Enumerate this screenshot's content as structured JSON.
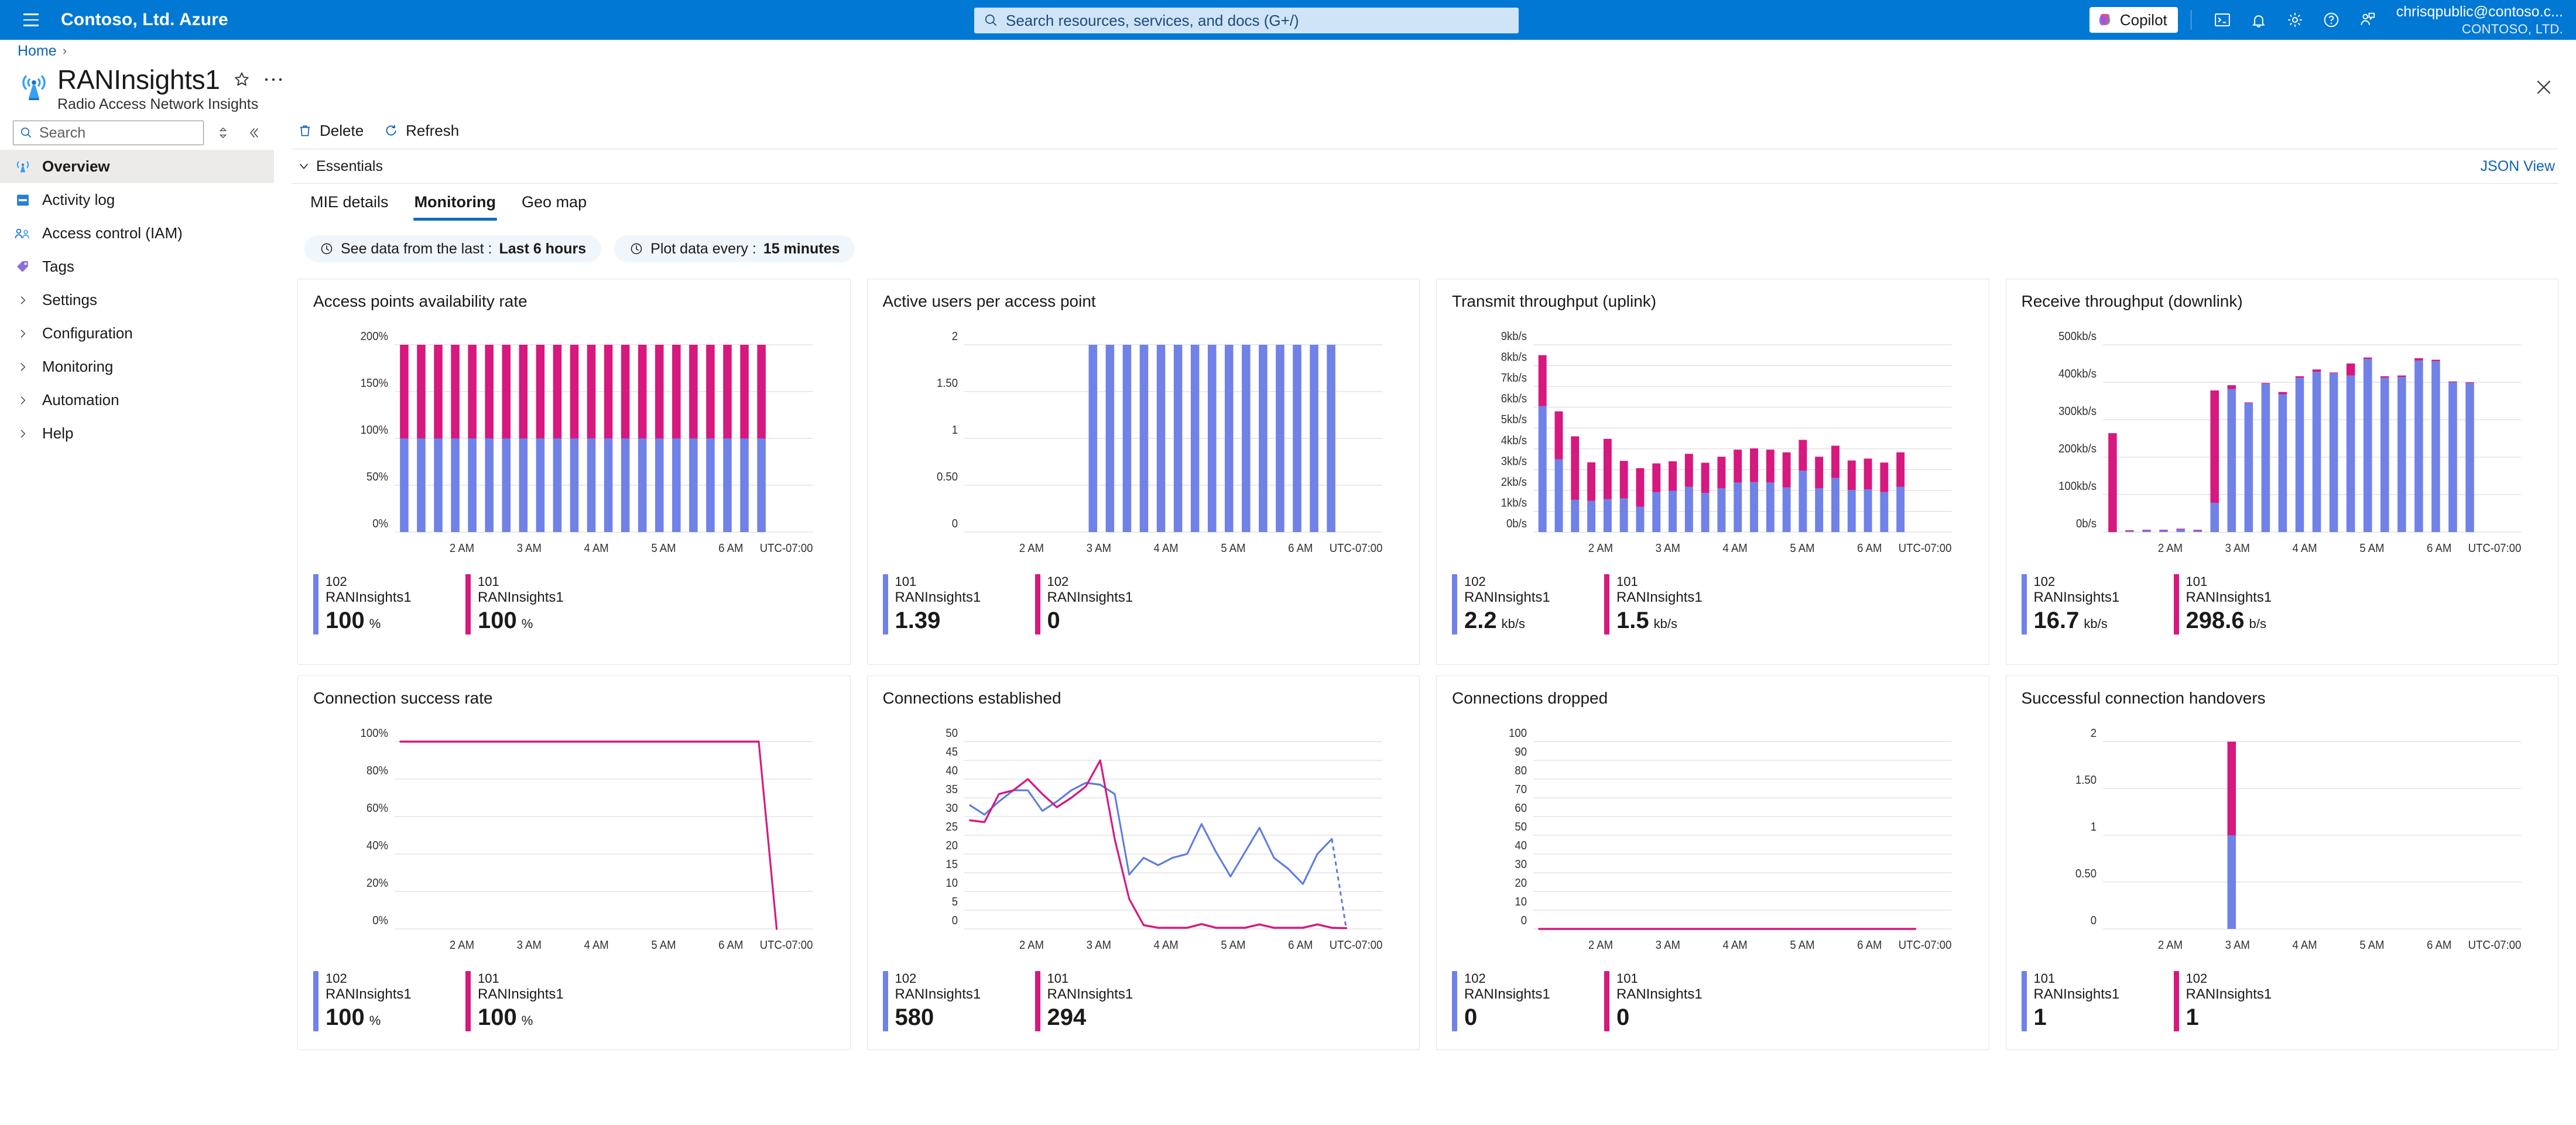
{
  "topbar": {
    "brand": "Contoso, Ltd. Azure",
    "search_placeholder": "Search resources, services, and docs (G+/)",
    "copilot_label": "Copilot",
    "account_email": "chrisqpublic@contoso.c...",
    "account_org": "CONTOSO, LTD.",
    "icons": [
      "hamburger-icon",
      "search-icon",
      "cloud-shell-icon",
      "notifications-bell-icon",
      "settings-gear-icon",
      "help-question-icon",
      "feedback-icon"
    ]
  },
  "breadcrumb": {
    "home": "Home",
    "separator": "›"
  },
  "page": {
    "title": "RANInsights1",
    "subtitle": "Radio Access Network Insights",
    "close_label": "✕"
  },
  "sidebar": {
    "search_placeholder": "Search",
    "items": [
      {
        "label": "Overview",
        "icon": "radio-tower-icon",
        "expandable": false,
        "active": true
      },
      {
        "label": "Activity log",
        "icon": "activity-log-icon",
        "expandable": false,
        "active": false
      },
      {
        "label": "Access control (IAM)",
        "icon": "access-control-icon",
        "expandable": false,
        "active": false
      },
      {
        "label": "Tags",
        "icon": "tag-icon",
        "expandable": false,
        "active": false
      },
      {
        "label": "Settings",
        "icon": "chevron-right-icon",
        "expandable": true,
        "active": false
      },
      {
        "label": "Configuration",
        "icon": "chevron-right-icon",
        "expandable": true,
        "active": false
      },
      {
        "label": "Monitoring",
        "icon": "chevron-right-icon",
        "expandable": true,
        "active": false
      },
      {
        "label": "Automation",
        "icon": "chevron-right-icon",
        "expandable": true,
        "active": false
      },
      {
        "label": "Help",
        "icon": "chevron-right-icon",
        "expandable": true,
        "active": false
      }
    ]
  },
  "commandbar": {
    "delete_label": "Delete",
    "refresh_label": "Refresh"
  },
  "essentials": {
    "label": "Essentials",
    "json_view": "JSON View"
  },
  "tabs": [
    {
      "label": "MIE details",
      "selected": false
    },
    {
      "label": "Monitoring",
      "selected": true
    },
    {
      "label": "Geo map",
      "selected": false
    }
  ],
  "pills": [
    {
      "prefix": "See data from the last :",
      "value": "Last 6 hours"
    },
    {
      "prefix": "Plot data every :",
      "value": "15 minutes"
    }
  ],
  "colors": {
    "blue": "#7081e8",
    "pink": "#d6187f",
    "accent": "#0078d4",
    "grid": "#d6d6d6",
    "axis_text": "#605e5c"
  },
  "chart_data": [
    {
      "type": "bar",
      "title": "Access points availability rate",
      "stacked": true,
      "xlabel": "",
      "ylabel": "",
      "ylim": [
        0,
        200
      ],
      "yticks": [
        "0%",
        "50%",
        "100%",
        "150%",
        "200%"
      ],
      "xticks": [
        "2 AM",
        "3 AM",
        "4 AM",
        "5 AM",
        "6 AM",
        "UTC-07:00"
      ],
      "series": [
        {
          "name": "102 RANInsights1",
          "color": "#7081e8",
          "values": [
            100,
            100,
            100,
            100,
            100,
            100,
            100,
            100,
            100,
            100,
            100,
            100,
            100,
            100,
            100,
            100,
            100,
            100,
            100,
            100,
            100,
            100
          ]
        },
        {
          "name": "101 RANInsights1",
          "color": "#d6187f",
          "values": [
            100,
            100,
            100,
            100,
            100,
            100,
            100,
            100,
            100,
            100,
            100,
            100,
            100,
            100,
            100,
            100,
            100,
            100,
            100,
            100,
            100,
            100
          ]
        }
      ],
      "legend": [
        {
          "id": "102",
          "resource": "RANInsights1",
          "value": "100",
          "unit": "%",
          "color": "#7081e8"
        },
        {
          "id": "101",
          "resource": "RANInsights1",
          "value": "100",
          "unit": "%",
          "color": "#d6187f"
        }
      ]
    },
    {
      "type": "bar",
      "title": "Active users per access point",
      "stacked": true,
      "xlabel": "",
      "ylabel": "",
      "ylim": [
        0,
        2
      ],
      "yticks": [
        "0",
        "0.50",
        "1",
        "1.50",
        "2"
      ],
      "xticks": [
        "2 AM",
        "3 AM",
        "4 AM",
        "5 AM",
        "6 AM",
        "UTC-07:00"
      ],
      "series": [
        {
          "name": "101 RANInsights1",
          "color": "#7081e8",
          "values": [
            0,
            0,
            0,
            0,
            0,
            0,
            0,
            2,
            2,
            2,
            2,
            2,
            2,
            2,
            2,
            2,
            2,
            2,
            2,
            2,
            2,
            2
          ]
        },
        {
          "name": "102 RANInsights1",
          "color": "#d6187f",
          "values": [
            0,
            0,
            0,
            0,
            0,
            0,
            0,
            0,
            0,
            0,
            0,
            0,
            0,
            0,
            0,
            0,
            0,
            0,
            0,
            0,
            0,
            0
          ]
        }
      ],
      "legend": [
        {
          "id": "101",
          "resource": "RANInsights1",
          "value": "1.39",
          "unit": "",
          "color": "#7081e8"
        },
        {
          "id": "102",
          "resource": "RANInsights1",
          "value": "0",
          "unit": "",
          "color": "#d6187f"
        }
      ]
    },
    {
      "type": "bar",
      "title": "Transmit throughput (uplink)",
      "stacked": true,
      "xlabel": "",
      "ylabel": "",
      "ylim": [
        0,
        9
      ],
      "yticks": [
        "0b/s",
        "1kb/s",
        "2kb/s",
        "3kb/s",
        "4kb/s",
        "5kb/s",
        "6kb/s",
        "7kb/s",
        "8kb/s",
        "9kb/s"
      ],
      "xticks": [
        "2 AM",
        "3 AM",
        "4 AM",
        "5 AM",
        "6 AM",
        "UTC-07:00"
      ],
      "series": [
        {
          "name": "102 RANInsights1",
          "color": "#7081e8",
          "values": [
            6.05,
            3.5,
            1.55,
            1.5,
            1.58,
            1.62,
            1.22,
            1.92,
            1.98,
            2.18,
            1.88,
            2.1,
            2.38,
            2.4,
            2.38,
            2.15,
            2.95,
            2.1,
            2.6,
            2.02,
            2.05,
            1.92,
            2.18
          ]
        },
        {
          "name": "101 RANInsights1",
          "color": "#d6187f",
          "values": [
            2.45,
            2.3,
            3.05,
            1.85,
            2.9,
            1.8,
            1.85,
            1.38,
            1.42,
            1.58,
            1.45,
            1.52,
            1.58,
            1.62,
            1.58,
            1.68,
            1.48,
            1.52,
            1.55,
            1.42,
            1.48,
            1.42,
            1.65
          ]
        }
      ],
      "legend": [
        {
          "id": "102",
          "resource": "RANInsights1",
          "value": "2.2",
          "unit": "kb/s",
          "color": "#7081e8"
        },
        {
          "id": "101",
          "resource": "RANInsights1",
          "value": "1.5",
          "unit": "kb/s",
          "color": "#d6187f"
        }
      ]
    },
    {
      "type": "bar",
      "title": "Receive throughput (downlink)",
      "stacked": true,
      "xlabel": "",
      "ylabel": "",
      "ylim": [
        0,
        500
      ],
      "yticks": [
        "0b/s",
        "100kb/s",
        "200kb/s",
        "300kb/s",
        "400kb/s",
        "500kb/s"
      ],
      "xticks": [
        "2 AM",
        "3 AM",
        "4 AM",
        "5 AM",
        "6 AM",
        "UTC-07:00"
      ],
      "series": [
        {
          "name": "102 RANInsights1",
          "color": "#7081e8",
          "values": [
            0,
            3,
            4,
            4,
            7,
            4,
            78,
            382,
            344,
            396,
            368,
            412,
            428,
            424,
            418,
            462,
            412,
            414,
            458,
            456,
            400,
            398
          ]
        },
        {
          "name": "101 RANInsights1",
          "color": "#d6187f",
          "values": [
            264,
            2,
            2,
            2,
            2,
            2,
            300,
            10,
            2,
            2,
            6,
            4,
            6,
            2,
            32,
            4,
            4,
            4,
            6,
            4,
            2,
            2
          ]
        }
      ],
      "legend": [
        {
          "id": "102",
          "resource": "RANInsights1",
          "value": "16.7",
          "unit": "kb/s",
          "color": "#7081e8"
        },
        {
          "id": "101",
          "resource": "RANInsights1",
          "value": "298.6",
          "unit": "b/s",
          "color": "#d6187f"
        }
      ]
    },
    {
      "type": "line",
      "title": "Connection success rate",
      "xlabel": "",
      "ylabel": "",
      "ylim": [
        0,
        100
      ],
      "yticks": [
        "0%",
        "20%",
        "40%",
        "60%",
        "80%",
        "100%"
      ],
      "xticks": [
        "2 AM",
        "3 AM",
        "4 AM",
        "5 AM",
        "6 AM",
        "UTC-07:00"
      ],
      "series": [
        {
          "name": "101 RANInsights1",
          "color": "#d6187f",
          "values": [
            100,
            100,
            100,
            100,
            100,
            100,
            100,
            100,
            100,
            100,
            100,
            100,
            100,
            100,
            100,
            100,
            100,
            100,
            100,
            100,
            100,
            0
          ]
        }
      ],
      "legend": [
        {
          "id": "102",
          "resource": "RANInsights1",
          "value": "100",
          "unit": "%",
          "color": "#7081e8"
        },
        {
          "id": "101",
          "resource": "RANInsights1",
          "value": "100",
          "unit": "%",
          "color": "#d6187f"
        }
      ]
    },
    {
      "type": "line",
      "title": "Connections established",
      "xlabel": "",
      "ylabel": "",
      "ylim": [
        0,
        50
      ],
      "yticks": [
        "0",
        "5",
        "10",
        "15",
        "20",
        "25",
        "30",
        "35",
        "40",
        "45",
        "50"
      ],
      "xticks": [
        "2 AM",
        "3 AM",
        "4 AM",
        "5 AM",
        "6 AM",
        "UTC-07:00"
      ],
      "series": [
        {
          "name": "102 RANInsights1",
          "color": "#5b7ce0",
          "values": [
            33,
            30.5,
            34,
            37,
            37,
            31.5,
            34,
            37,
            39,
            38.5,
            36,
            14.5,
            19,
            17,
            19,
            20,
            28,
            20.5,
            14,
            20.5,
            27,
            19,
            16,
            12,
            20,
            24,
            0
          ],
          "dashed_tail": true
        },
        {
          "name": "101 RANInsights1",
          "color": "#d6187f",
          "values": [
            29,
            28.5,
            36,
            37,
            40,
            36,
            32.5,
            35,
            38,
            45,
            24,
            8,
            1,
            0.3,
            0.3,
            0.3,
            1.3,
            0.3,
            0.3,
            0.3,
            1.2,
            0.3,
            0.3,
            0.3,
            1.2,
            0.3,
            0.2
          ]
        }
      ],
      "legend": [
        {
          "id": "102",
          "resource": "RANInsights1",
          "value": "580",
          "unit": "",
          "color": "#7081e8"
        },
        {
          "id": "101",
          "resource": "RANInsights1",
          "value": "294",
          "unit": "",
          "color": "#d6187f"
        }
      ]
    },
    {
      "type": "line",
      "title": "Connections dropped",
      "xlabel": "",
      "ylabel": "",
      "ylim": [
        0,
        100
      ],
      "yticks": [
        "0",
        "10",
        "20",
        "30",
        "40",
        "50",
        "60",
        "70",
        "80",
        "90",
        "100"
      ],
      "xticks": [
        "2 AM",
        "3 AM",
        "4 AM",
        "5 AM",
        "6 AM",
        "UTC-07:00"
      ],
      "series": [
        {
          "name": "101 RANInsights1",
          "color": "#d6187f",
          "values": [
            0,
            0,
            0,
            0,
            0,
            0,
            0,
            0,
            0,
            0,
            0,
            0,
            0,
            0,
            0,
            0,
            0,
            0,
            0,
            0,
            0,
            0
          ]
        }
      ],
      "legend": [
        {
          "id": "102",
          "resource": "RANInsights1",
          "value": "0",
          "unit": "",
          "color": "#7081e8"
        },
        {
          "id": "101",
          "resource": "RANInsights1",
          "value": "0",
          "unit": "",
          "color": "#d6187f"
        }
      ]
    },
    {
      "type": "bar",
      "title": "Successful connection handovers",
      "stacked": true,
      "xlabel": "",
      "ylabel": "",
      "ylim": [
        0,
        2
      ],
      "yticks": [
        "0",
        "0.50",
        "1",
        "1.50",
        "2"
      ],
      "xticks": [
        "2 AM",
        "3 AM",
        "4 AM",
        "5 AM",
        "6 AM",
        "UTC-07:00"
      ],
      "series": [
        {
          "name": "101 RANInsights1",
          "color": "#7081e8",
          "values": [
            0,
            0,
            0,
            0,
            0,
            0,
            0,
            1,
            0,
            0,
            0,
            0,
            0,
            0,
            0,
            0,
            0,
            0,
            0,
            0,
            0,
            0
          ]
        },
        {
          "name": "102 RANInsights1",
          "color": "#d6187f",
          "values": [
            0,
            0,
            0,
            0,
            0,
            0,
            0,
            1,
            0,
            0,
            0,
            0,
            0,
            0,
            0,
            0,
            0,
            0,
            0,
            0,
            0,
            0
          ]
        }
      ],
      "legend": [
        {
          "id": "101",
          "resource": "RANInsights1",
          "value": "1",
          "unit": "",
          "color": "#7081e8"
        },
        {
          "id": "102",
          "resource": "RANInsights1",
          "value": "1",
          "unit": "",
          "color": "#d6187f"
        }
      ]
    }
  ]
}
